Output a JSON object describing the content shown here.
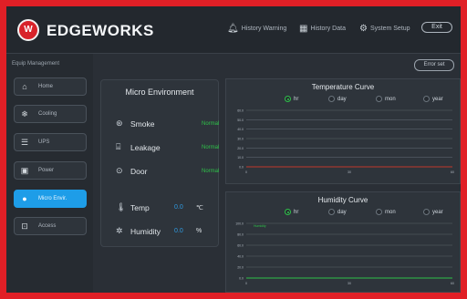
{
  "app": {
    "logo_mark": "W",
    "brand": "EDGEWORKS"
  },
  "header_nav": [
    {
      "label": "History Warning",
      "icon": "bell-icon"
    },
    {
      "label": "History Data",
      "icon": "chart-icon"
    },
    {
      "label": "System Setup",
      "icon": "gear-icon"
    }
  ],
  "exit_label": "Exit",
  "sidebar": {
    "title": "Equip Management",
    "items": [
      {
        "label": "Home",
        "icon": "home-icon",
        "active": false
      },
      {
        "label": "Cooling",
        "icon": "snowflake-icon",
        "active": false
      },
      {
        "label": "UPS",
        "icon": "ups-icon",
        "active": false
      },
      {
        "label": "Power",
        "icon": "power-icon",
        "active": false
      },
      {
        "label": "Micro Envir.",
        "icon": "droplet-icon",
        "active": true
      },
      {
        "label": "Access",
        "icon": "lock-icon",
        "active": false
      }
    ]
  },
  "error_button": "Error set",
  "micro_env": {
    "title": "Micro Environment",
    "smoke": {
      "label": "Smoke",
      "status": "Normal"
    },
    "leakage": {
      "label": "Leakage",
      "status": "Normal"
    },
    "door": {
      "label": "Door",
      "status": "Normal"
    },
    "temp": {
      "label": "Temp",
      "value": "0.0",
      "unit": "℃"
    },
    "humidity": {
      "label": "Humidity",
      "value": "0.0",
      "unit": "%"
    }
  },
  "colors": {
    "accent_blue": "#1e9de8",
    "normal_green": "#2ec24a",
    "temp_line": "#c0392b",
    "humidity_line": "#2ec24a"
  },
  "period_options": [
    "hr",
    "day",
    "mon",
    "year"
  ],
  "chart_data": [
    {
      "type": "line",
      "title": "Temperature Curve",
      "selected_period": "hr",
      "y_ticks": [
        "60.0",
        "50.0",
        "40.0",
        "30.0",
        "20.0",
        "10.0",
        "0.0"
      ],
      "ylim": [
        0,
        60
      ],
      "x_ticks": [
        "0",
        "30",
        "60"
      ],
      "series": [
        {
          "values": [
            0,
            0,
            0,
            0,
            0,
            0,
            0
          ]
        }
      ]
    },
    {
      "type": "line",
      "title": "Humidity Curve",
      "selected_period": "hr",
      "y_ticks": [
        "100.0",
        "80.0",
        "60.0",
        "40.0",
        "20.0",
        "0.0"
      ],
      "ylim": [
        0,
        100
      ],
      "x_ticks": [
        "0",
        "30",
        "60"
      ],
      "series": [
        {
          "name": "Humidity",
          "values": [
            0,
            0,
            0,
            0,
            0,
            0,
            0
          ]
        }
      ]
    }
  ]
}
